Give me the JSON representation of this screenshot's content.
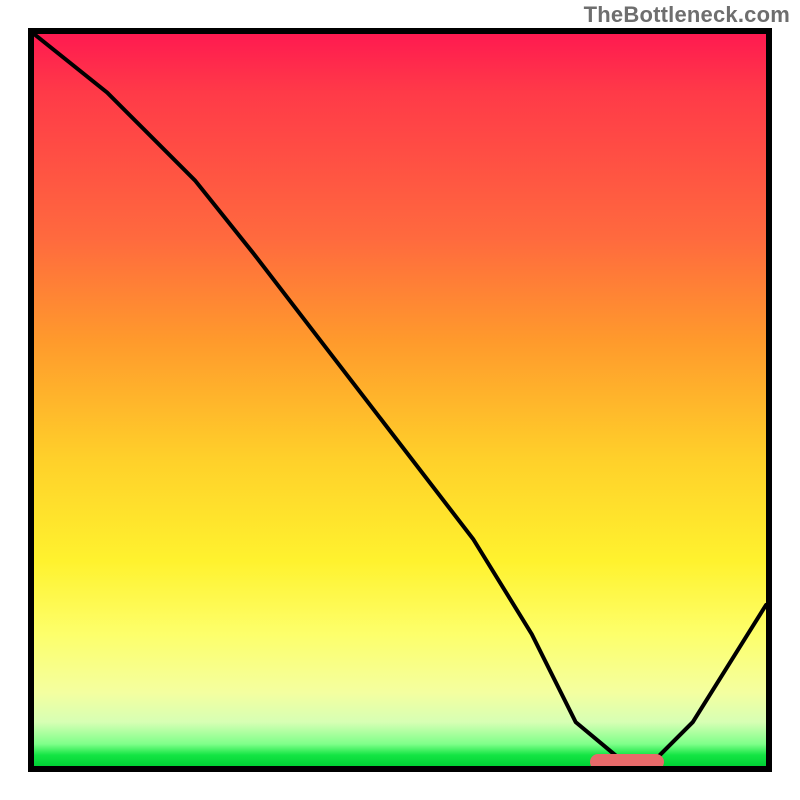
{
  "watermark": "TheBottleneck.com",
  "chart_data": {
    "type": "line",
    "title": "",
    "xlabel": "",
    "ylabel": "",
    "xlim": [
      0,
      100
    ],
    "ylim": [
      0,
      100
    ],
    "grid": false,
    "legend": false,
    "series": [
      {
        "name": "bottleneck-curve",
        "x": [
          0,
          10,
          22,
          30,
          40,
          50,
          60,
          68,
          74,
          80,
          85,
          90,
          100
        ],
        "y": [
          100,
          92,
          80,
          70,
          57,
          44,
          31,
          18,
          6,
          1,
          1,
          6,
          22
        ]
      }
    ],
    "marker": {
      "x_start": 76,
      "x_end": 86,
      "y": 0.5
    },
    "background_gradient": {
      "top_color": "#ff1a50",
      "mid_color": "#ffd02a",
      "bottom_color": "#00d234"
    }
  }
}
